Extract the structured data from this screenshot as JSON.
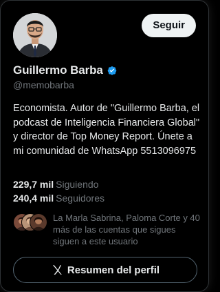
{
  "profile": {
    "follow_label": "Seguir",
    "display_name": "Guillermo Barba",
    "handle": "@memobarba",
    "bio": "Economista. Autor de \"Guillermo Barba, el podcast de Inteligencia Financiera Global\" y director de Top Money Report. Únete a mi comunidad de WhatsApp 5513096975",
    "verified_icon": "verified-badge-icon",
    "avatar_icon": "profile-photo"
  },
  "stats": {
    "following_count": "229,7 mil",
    "following_label": "Siguiendo",
    "followers_count": "240,4 mil",
    "followers_label": "Seguidores"
  },
  "followers_you_know": {
    "text": "La Marla Sabrina, Paloma Corte y 40 más de las cuentas que sigues siguen a este usuario"
  },
  "summary_button": {
    "label": "Resumen del perfil",
    "icon": "grok-icon"
  },
  "colors": {
    "background": "#000000",
    "text_primary": "#e7e9ea",
    "text_secondary": "#71767b",
    "verified_blue": "#1d9bf0",
    "follow_button_bg": "#eff3f4"
  }
}
